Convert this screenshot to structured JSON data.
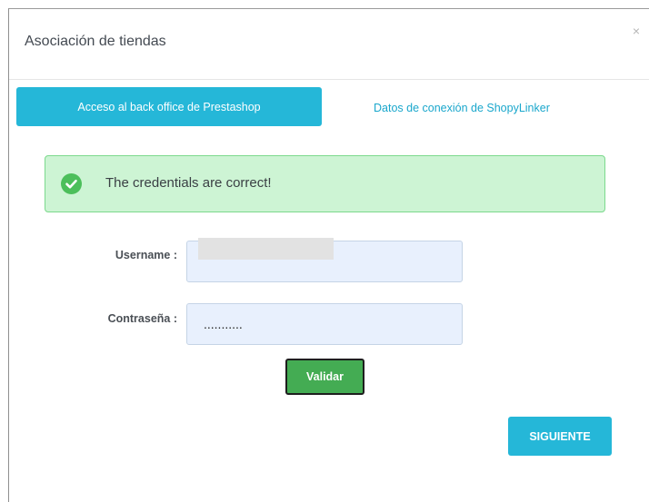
{
  "modal": {
    "title": "Asociación de tiendas",
    "close_symbol": "×"
  },
  "tabs": {
    "active_label": "Acceso al back office de Prestashop",
    "inactive_label": "Datos de conexión de ShopyLinker"
  },
  "alert": {
    "icon": "check-circle-icon",
    "message": "The credentials are correct!",
    "colors": {
      "background": "#cdf4d4",
      "border": "#7cd98d",
      "icon": "#4cbf5b"
    }
  },
  "form": {
    "username_label": "Username :",
    "username_value": "",
    "password_label": "Contraseña :",
    "password_value": "...........",
    "validate_label": "Validar"
  },
  "footer": {
    "next_label": "SIGUIENTE"
  },
  "colors": {
    "accent": "#25b7d8",
    "success_button": "#44ac53",
    "input_background": "#e8f0fd"
  }
}
